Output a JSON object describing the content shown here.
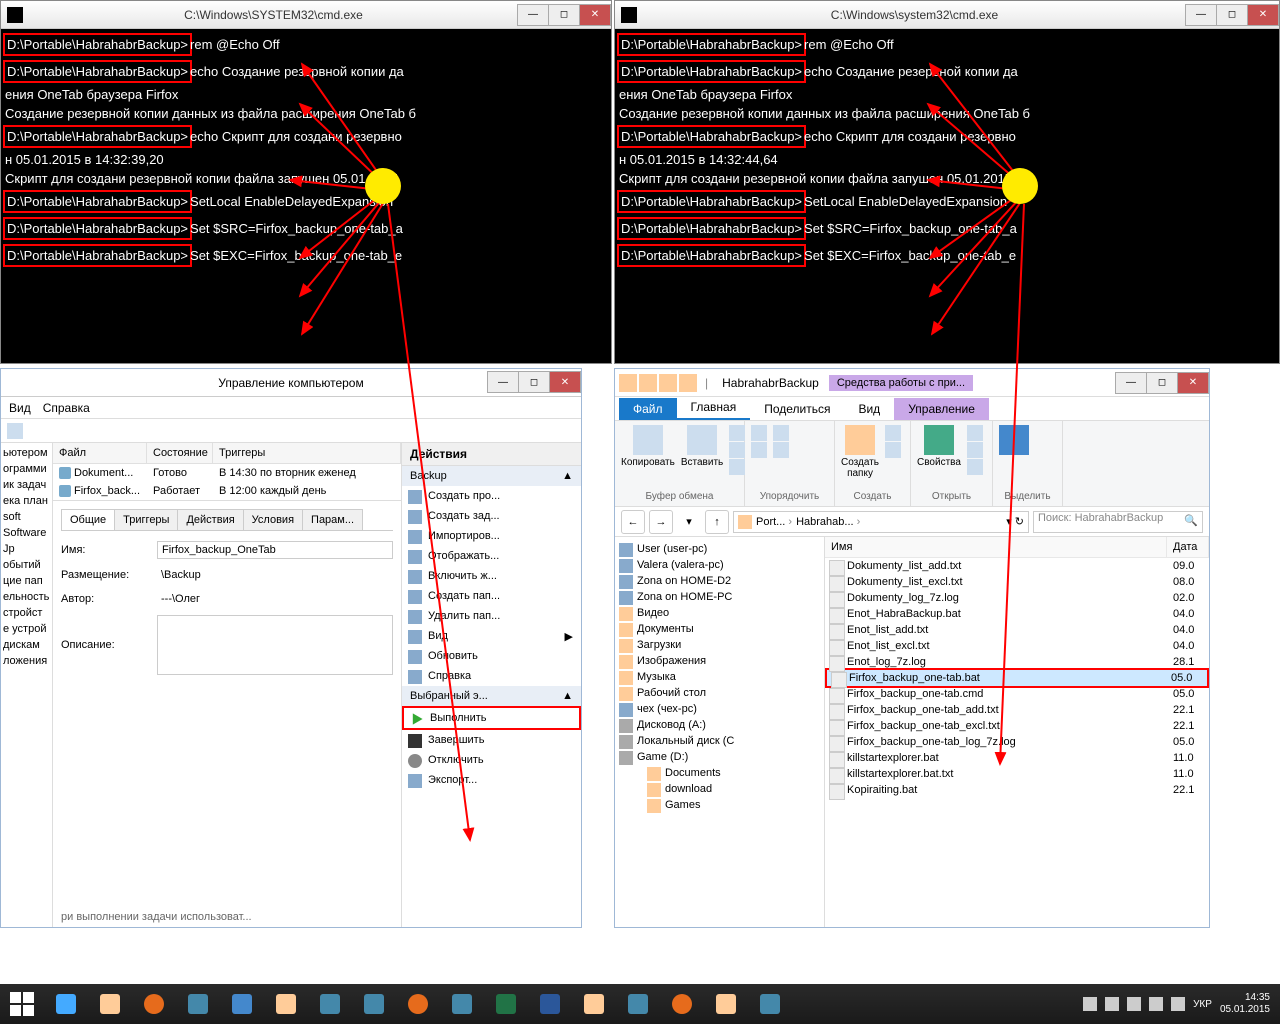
{
  "cmd_left": {
    "title": "C:\\Windows\\SYSTEM32\\cmd.exe",
    "lines": [
      {
        "prompt": "D:\\Portable\\HabrahabrBackup>",
        "cmd": "rem @Echo Off",
        "hl": true,
        "cont": ""
      },
      {
        "prompt": "D:\\Portable\\HabrahabrBackup>",
        "cmd": "echo Создание резервной копии да",
        "hl": true,
        "cont": "ения OneTab браузера Firfox\nСоздание резервной копии данных из файла расширения OneTab б"
      },
      {
        "prompt": "D:\\Portable\\HabrahabrBackup>",
        "cmd": "echo Скрипт для создани резервно",
        "hl": true,
        "cont": "н 05.01.2015 в 14:32:39,20\nСкрипт для создани резервной копии файла запушен 05.01.2015"
      },
      {
        "prompt": "D:\\Portable\\HabrahabrBackup>",
        "cmd": "SetLocal EnableDelayedExpansion",
        "hl": true,
        "cont": ""
      },
      {
        "prompt": "D:\\Portable\\HabrahabrBackup>",
        "cmd": "Set $SRC=Firfox_backup_one-tab_a",
        "hl": true,
        "cont": ""
      },
      {
        "prompt": "D:\\Portable\\HabrahabrBackup>",
        "cmd": "Set $EXC=Firfox_backup_one-tab_e",
        "hl": true,
        "cont": ""
      }
    ]
  },
  "cmd_right": {
    "title": "C:\\Windows\\system32\\cmd.exe",
    "lines": [
      {
        "prompt": "D:\\Portable\\HabrahabrBackup>",
        "cmd": "rem @Echo Off",
        "hl": true,
        "cont": ""
      },
      {
        "prompt": "D:\\Portable\\HabrahabrBackup>",
        "cmd": "echo Создание резервной копии да",
        "hl": true,
        "cont": "ения OneTab браузера Firfox\nСоздание резервной копии данных из файла расширения OneTab б"
      },
      {
        "prompt": "D:\\Portable\\HabrahabrBackup>",
        "cmd": "echo Скрипт для создани резервно",
        "hl": true,
        "cont": "н 05.01.2015 в 14:32:44,64\nСкрипт для создани резервной копии файла запушен 05.01.2015"
      },
      {
        "prompt": "D:\\Portable\\HabrahabrBackup>",
        "cmd": "SetLocal EnableDelayedExpansion",
        "hl": true,
        "cont": ""
      },
      {
        "prompt": "D:\\Portable\\HabrahabrBackup>",
        "cmd": "Set $SRC=Firfox_backup_one-tab_a",
        "hl": true,
        "cont": ""
      },
      {
        "prompt": "D:\\Portable\\HabrahabrBackup>",
        "cmd": "Set $EXC=Firfox_backup_one-tab_e",
        "hl": true,
        "cont": ""
      }
    ]
  },
  "mgmt": {
    "title": "Управление компьютером",
    "menu": {
      "view": "Вид",
      "help": "Справка"
    },
    "left_items": [
      "ьютером",
      "ограмми",
      "ик задач",
      "ека план",
      "",
      "soft",
      "Software",
      "",
      "Jp",
      "",
      "обытий",
      "цие пап",
      "",
      "ельность",
      "стройст",
      "е устрой",
      "дискам",
      "",
      "ложения"
    ],
    "tasks_head": {
      "file": "Файл",
      "state": "Состояние",
      "trigger": "Триггеры"
    },
    "tasks": [
      {
        "name": "Dokument...",
        "state": "Готово",
        "trigger": "В 14:30 по вторник еженед"
      },
      {
        "name": "Firfox_back...",
        "state": "Работает",
        "trigger": "В 12:00 каждый день"
      }
    ],
    "tabs": [
      "Общие",
      "Триггеры",
      "Действия",
      "Условия",
      "Парам..."
    ],
    "props": {
      "name_lbl": "Имя:",
      "name_val": "Firfox_backup_OneTab",
      "loc_lbl": "Размещение:",
      "loc_val": "\\Backup",
      "author_lbl": "Автор:",
      "author_val": "---\\Олег",
      "desc_lbl": "Описание:"
    },
    "actions": {
      "header": "Действия",
      "group1": "Backup",
      "items1": [
        "Создать про...",
        "Создать зад...",
        "Импортиров...",
        "Отображать...",
        "Включить ж...",
        "Создать пап...",
        "Удалить пап..."
      ],
      "view": "Вид",
      "refresh": "Обновить",
      "help": "Справка",
      "group2": "Выбранный э...",
      "run": "Выполнить",
      "end": "Завершить",
      "disable": "Отключить",
      "export": "Экспорт..."
    }
  },
  "explorer": {
    "title": "HabrahabrBackup",
    "tool": "Средства работы с при...",
    "tabs": {
      "file": "Файл",
      "home": "Главная",
      "share": "Поделиться",
      "view": "Вид",
      "manage": "Управление"
    },
    "ribbon": {
      "copy": "Копировать",
      "paste": "Вставить",
      "clipboard": "Буфер обмена",
      "organize": "Упорядочить",
      "newfolder": "Создать\nпапку",
      "new": "Создать",
      "props": "Свойства",
      "open": "Открыть",
      "select": "Выделить"
    },
    "addr": {
      "seg1": "Port...",
      "seg2": "Habrahab..."
    },
    "search_placeholder": "Поиск: HabrahabrBackup",
    "tree": [
      {
        "t": "User (user-pc)",
        "c": "pc"
      },
      {
        "t": "Valera (valera-pc)",
        "c": "pc"
      },
      {
        "t": "Zona on HOME-D2",
        "c": "pc"
      },
      {
        "t": "Zona on HOME-PC",
        "c": "pc"
      },
      {
        "t": "Видео",
        "c": ""
      },
      {
        "t": "Документы",
        "c": ""
      },
      {
        "t": "Загрузки",
        "c": ""
      },
      {
        "t": "Изображения",
        "c": ""
      },
      {
        "t": "Музыка",
        "c": ""
      },
      {
        "t": "Рабочий стол",
        "c": ""
      },
      {
        "t": "чех (чех-рс)",
        "c": "pc"
      },
      {
        "t": "Дисковод (A:)",
        "c": "drv"
      },
      {
        "t": "Локальный диск (C",
        "c": "drv"
      },
      {
        "t": "Game (D:)",
        "c": "drv"
      },
      {
        "t": "Documents",
        "c": "ind2"
      },
      {
        "t": "download",
        "c": "ind2"
      },
      {
        "t": "Games",
        "c": "ind2"
      }
    ],
    "files_head": {
      "name": "Имя",
      "date": "Дата"
    },
    "files": [
      {
        "n": "Dokumenty_list_add.txt",
        "d": "09.0"
      },
      {
        "n": "Dokumenty_list_excl.txt",
        "d": "08.0"
      },
      {
        "n": "Dokumenty_log_7z.log",
        "d": "02.0"
      },
      {
        "n": "Enot_HabraBackup.bat",
        "d": "04.0"
      },
      {
        "n": "Enot_list_add.txt",
        "d": "04.0"
      },
      {
        "n": "Enot_list_excl.txt",
        "d": "04.0"
      },
      {
        "n": "Enot_log_7z.log",
        "d": "28.1"
      },
      {
        "n": "Firfox_backup_one-tab.bat",
        "d": "05.0",
        "sel": true
      },
      {
        "n": "Firfox_backup_one-tab.cmd",
        "d": "05.0"
      },
      {
        "n": "Firfox_backup_one-tab_add.txt",
        "d": "22.1"
      },
      {
        "n": "Firfox_backup_one-tab_excl.txt",
        "d": "22.1"
      },
      {
        "n": "Firfox_backup_one-tab_log_7z.log",
        "d": "05.0"
      },
      {
        "n": "killstartexplorer.bat",
        "d": "11.0"
      },
      {
        "n": "killstartexplorer.bat.txt",
        "d": "11.0"
      },
      {
        "n": "Kopiraiting.bat",
        "d": "22.1"
      }
    ]
  },
  "taskbar": {
    "lang": "УКР",
    "time": "14:35",
    "date": "05.01.2015"
  },
  "footer_text": "ри выполнении задачи использоват..."
}
